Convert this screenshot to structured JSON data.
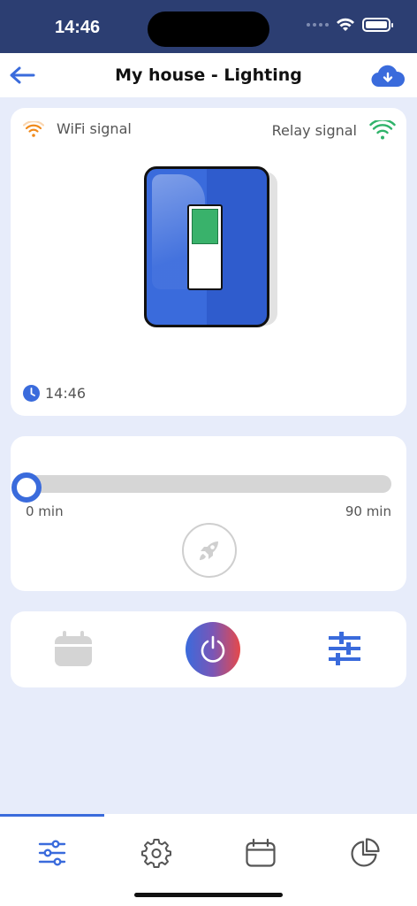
{
  "status_bar": {
    "time": "14:46"
  },
  "header": {
    "title": "My house - Lighting"
  },
  "device": {
    "wifi_label": "WiFi signal",
    "relay_label": "Relay signal",
    "switch_state_on": true,
    "last_update_time": "14:46",
    "colors": {
      "wifi": "#f08a1c",
      "relay": "#2fb36a",
      "switch_blue": "#3a6bdc",
      "switch_on": "#39b26b"
    }
  },
  "timer": {
    "min_label": "0 min",
    "max_label": "90 min",
    "value_fraction": 0
  },
  "actions": {
    "power_gradient": [
      "#3a6bdc",
      "#e6494a"
    ]
  },
  "bottom_nav": {
    "tabs": [
      {
        "icon": "sliders-icon",
        "active": true
      },
      {
        "icon": "gear-icon",
        "active": false
      },
      {
        "icon": "calendar-icon",
        "active": false
      },
      {
        "icon": "pie-chart-icon",
        "active": false
      }
    ],
    "accent": "#3a6bdc"
  }
}
